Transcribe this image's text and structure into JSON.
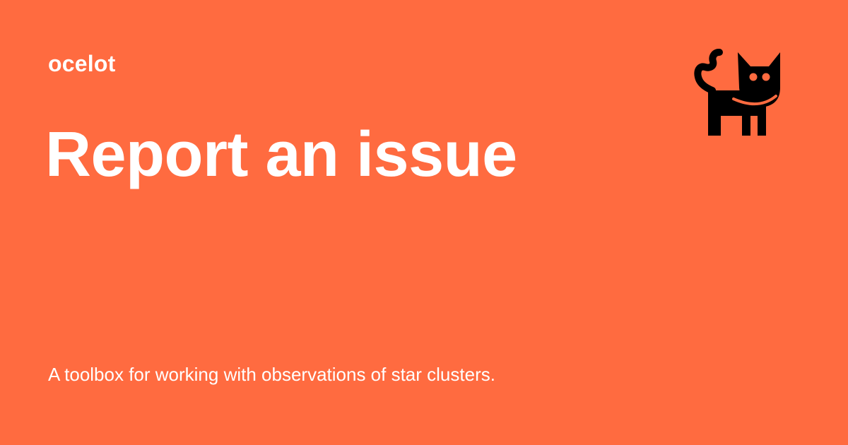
{
  "site": {
    "name": "ocelot"
  },
  "page": {
    "title": "Report an issue",
    "description": "A toolbox for working with observations of star clusters."
  },
  "logo": {
    "icon": "cat-icon"
  },
  "colors": {
    "background": "#FF6B40",
    "text": "#FFFFFF",
    "logo": "#000000"
  }
}
